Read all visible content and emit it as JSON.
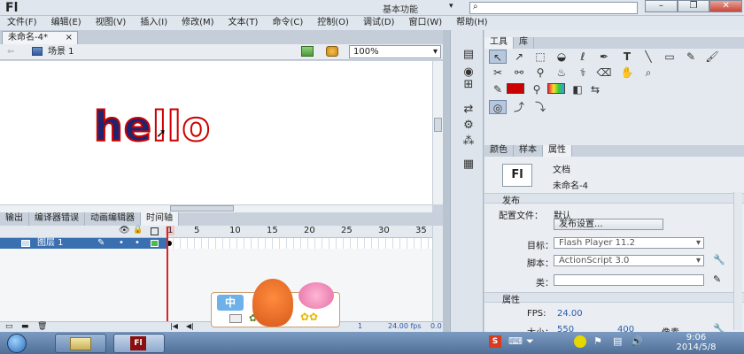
{
  "app": {
    "logo": "Fl",
    "workspace": "基本功能",
    "search_placeholder": ""
  },
  "window_controls": {
    "minimize": "–",
    "restore": "❐",
    "close": "✕"
  },
  "menu": [
    "文件(F)",
    "编辑(E)",
    "视图(V)",
    "插入(I)",
    "修改(M)",
    "文本(T)",
    "命令(C)",
    "控制(O)",
    "调试(D)",
    "窗口(W)",
    "帮助(H)"
  ],
  "document": {
    "tab": "未命名-4*",
    "tab_close": "×"
  },
  "scene": {
    "label": "场景 1",
    "zoom": "100%"
  },
  "stage": {
    "text_h": "h",
    "text_e": "e",
    "text_l1": "l",
    "text_l2": "l",
    "text_o": "o"
  },
  "timeline": {
    "tabs": [
      "输出",
      "编译器错误",
      "动画编辑器",
      "时间轴"
    ],
    "active_tab": "时间轴",
    "frame_numbers": [
      "1",
      "5",
      "10",
      "15",
      "20",
      "25",
      "30",
      "35"
    ],
    "layer_name": "图层 1",
    "current_frame": "1",
    "fps": "24.00 fps",
    "elapsed": "0.0"
  },
  "tools_panel": {
    "tabs": [
      "工具",
      "库"
    ],
    "active": "工具"
  },
  "props_panel": {
    "tabs": [
      "颜色",
      "样本",
      "属性"
    ],
    "active": "属性",
    "doc_icon": "Fl",
    "doc_type": "文档",
    "doc_name": "未命名-4",
    "section_publish": "发布",
    "config_label": "配置文件：",
    "config_value": "默认",
    "publish_settings_btn": "发布设置...",
    "target_label": "目标：",
    "target_value": "Flash Player 11.2",
    "script_label": "脚本：",
    "script_value": "ActionScript 3.0",
    "class_label": "类：",
    "class_value": "",
    "section_props": "属性",
    "fps_label": "FPS:",
    "fps_value": "24.00",
    "size_label": "大小：",
    "size_w": "550",
    "size_h": "400",
    "size_unit": "像素"
  },
  "ime": {
    "label": "中"
  },
  "clock": {
    "time": "9:06",
    "date": "2014/5/8"
  },
  "colors": {
    "stroke": "#cc0000",
    "fill": "#1f2470",
    "accent": "#3a6fb0"
  }
}
